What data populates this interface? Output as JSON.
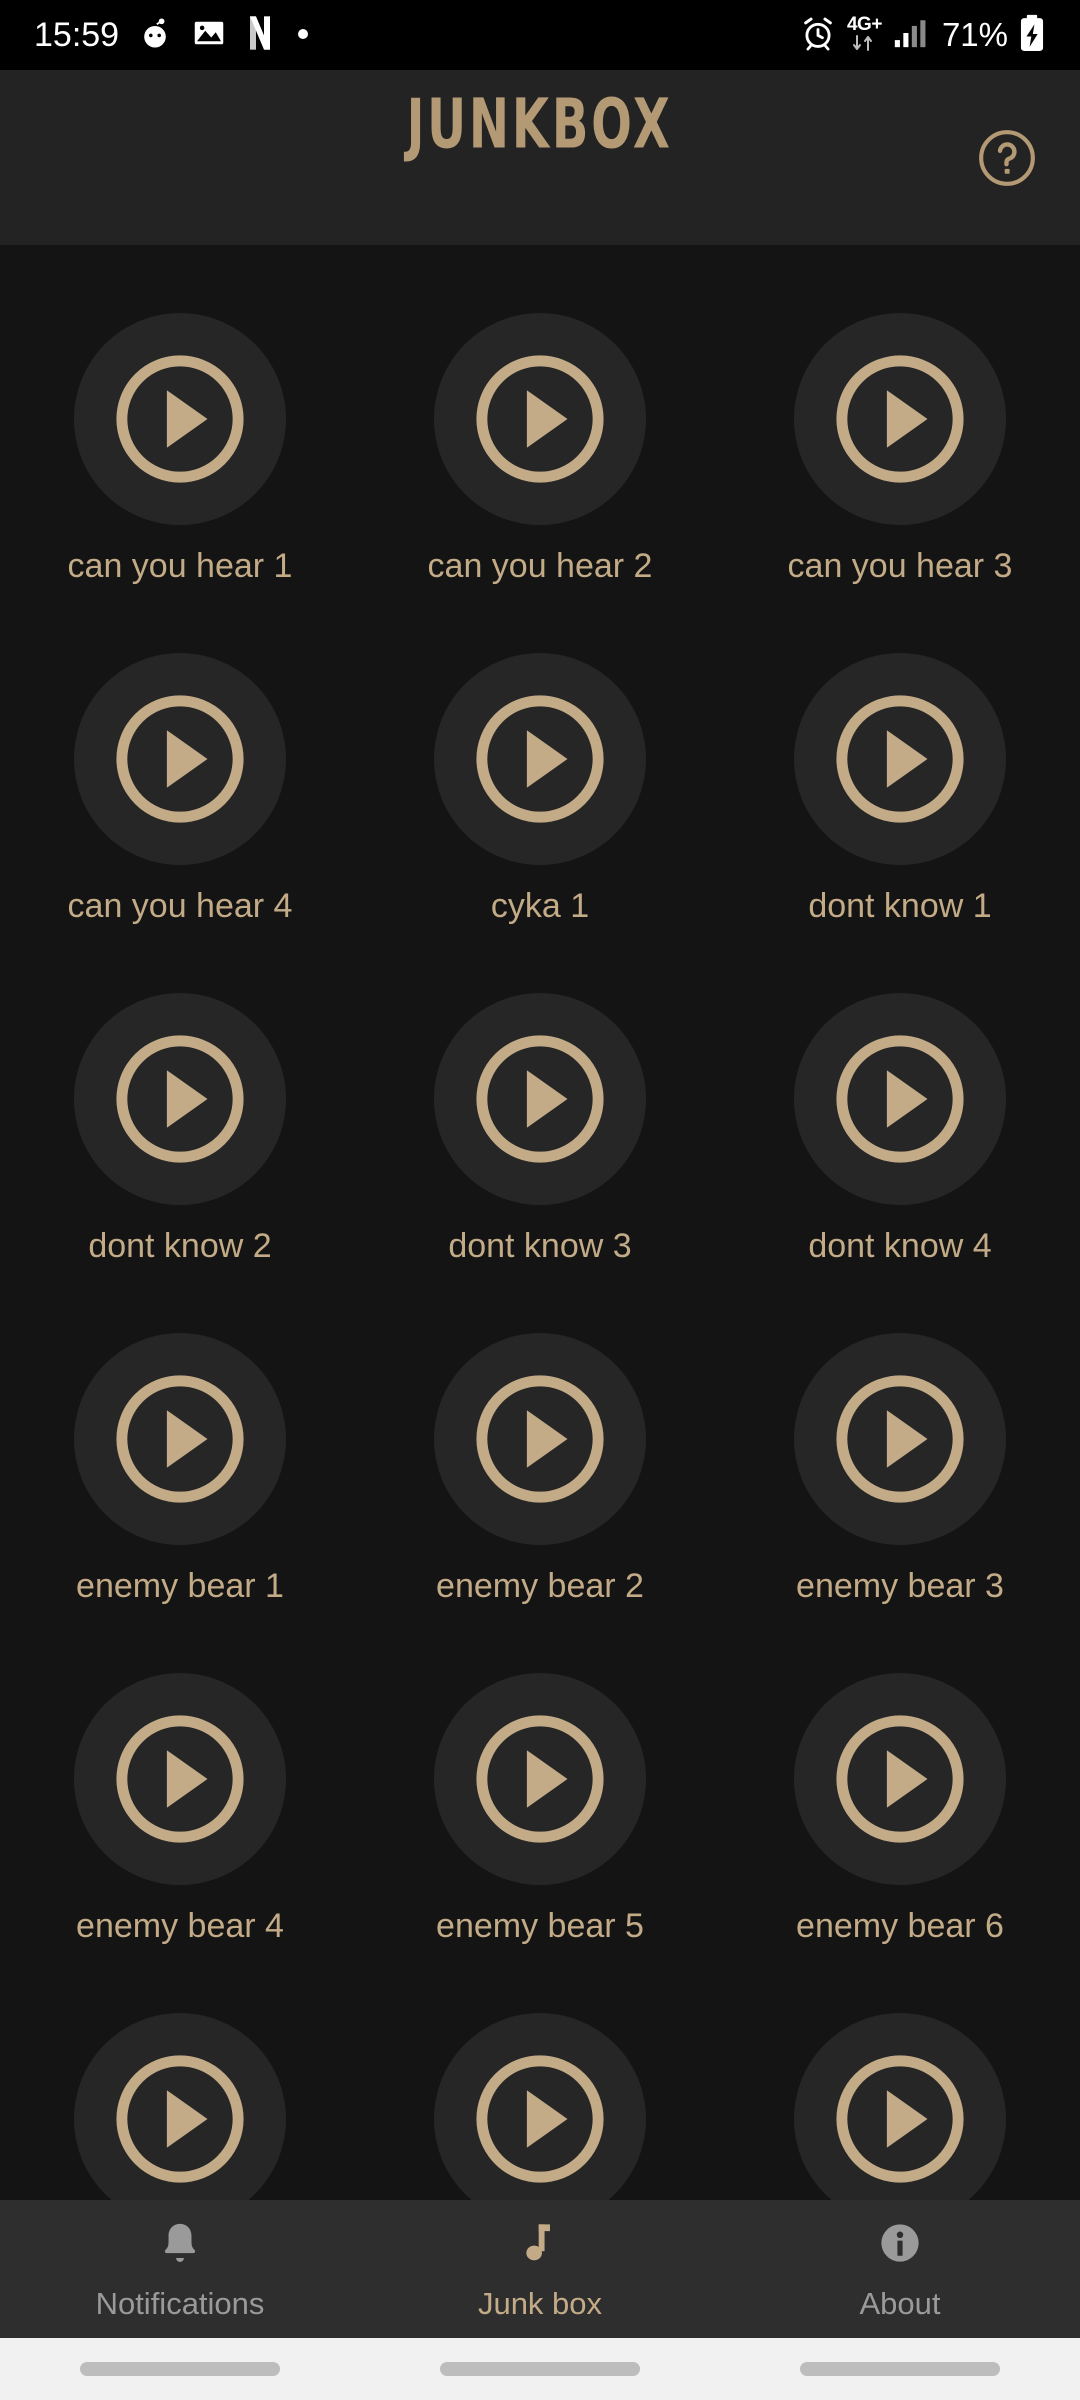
{
  "status_bar": {
    "time": "15:59",
    "left_icons": [
      "reddit-icon",
      "gallery-icon",
      "netflix-icon",
      "dot-icon"
    ],
    "alarm_icon": "alarm-clock-icon",
    "network_label": "4G+",
    "network_arrows": "up-down-arrows-icon",
    "signal_icon": "signal-bars-icon",
    "battery_percent": "71%",
    "battery_icon": "battery-charging-icon"
  },
  "header": {
    "title": "JUNKBOX",
    "help_icon": "help-circle-icon"
  },
  "colors": {
    "accent": "#c3ab87",
    "logo": "#b49a74",
    "page_background": "#141414",
    "header_background": "#232323",
    "pad_background": "#262626",
    "nav_background": "#2e2e2e",
    "nav_inactive": "#9a9a9a",
    "status_bar_background": "#000000",
    "system_bar_background": "#f1f1f1"
  },
  "sound_grid": {
    "play_icon": "play-circle-icon",
    "rows": [
      [
        "can you hear 1",
        "can you hear 2",
        "can you hear 3"
      ],
      [
        "can you hear 4",
        "cyka 1",
        "dont know 1"
      ],
      [
        "dont know 2",
        "dont know 3",
        "dont know 4"
      ],
      [
        "enemy bear 1",
        "enemy bear 2",
        "enemy bear 3"
      ],
      [
        "enemy bear 4",
        "enemy bear 5",
        "enemy bear 6"
      ],
      [
        "",
        "",
        ""
      ]
    ]
  },
  "bottom_nav": {
    "items": [
      {
        "label": "Notifications",
        "icon": "bell-icon",
        "active": false
      },
      {
        "label": "Junk box",
        "icon": "music-note-icon",
        "active": true
      },
      {
        "label": "About",
        "icon": "info-circle-icon",
        "active": false
      }
    ]
  },
  "system_bar": {
    "buttons": [
      "recents-button",
      "home-button",
      "back-button"
    ]
  }
}
